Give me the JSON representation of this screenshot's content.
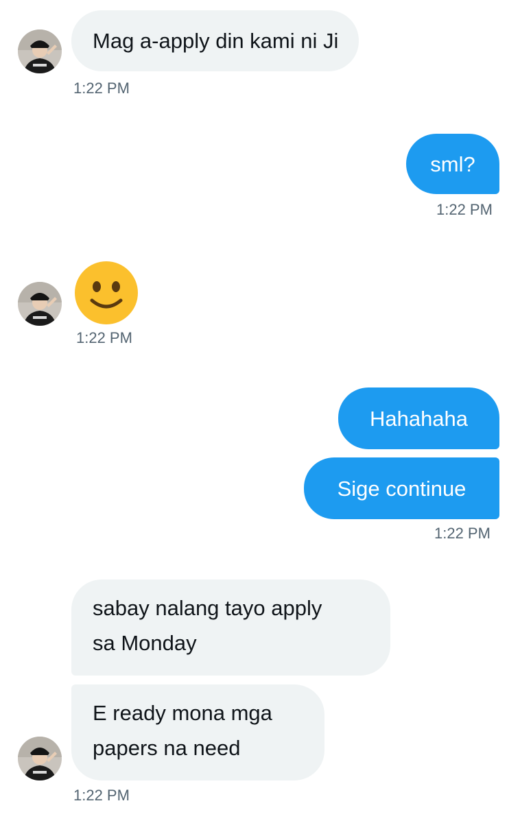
{
  "conversation": {
    "messages": [
      {
        "direction": "incoming",
        "text": "Mag a-apply din kami ni Ji",
        "time": "1:22 PM"
      },
      {
        "direction": "outgoing",
        "text": "sml?",
        "time": "1:22 PM"
      },
      {
        "direction": "incoming",
        "emoji": "slightly-smiling-face",
        "time": "1:22 PM"
      },
      {
        "direction": "outgoing",
        "text": "Hahahaha"
      },
      {
        "direction": "outgoing",
        "text": "Sige continue",
        "time": "1:22 PM"
      },
      {
        "direction": "incoming",
        "lines": [
          "sabay nalang tayo apply",
          "sa Monday"
        ]
      },
      {
        "direction": "incoming",
        "lines": [
          "E ready mona mga",
          "papers na need"
        ],
        "time": "1:22 PM"
      }
    ]
  },
  "colors": {
    "incoming_bubble": "#eff3f4",
    "outgoing_bubble": "#1d9bf0",
    "timestamp": "#536471",
    "emoji_face": "#fbc02d"
  }
}
